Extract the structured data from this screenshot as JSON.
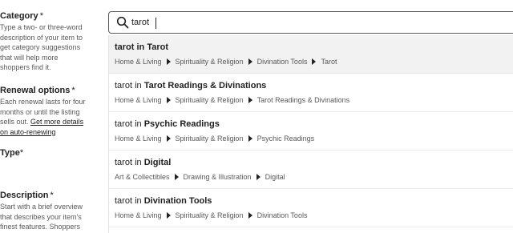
{
  "form": {
    "category": {
      "title": "Category",
      "required_mark": "*",
      "help": "Type a two- or three-word description of your item to get category suggestions that will help more shoppers find it."
    },
    "renewal": {
      "title": "Renewal options",
      "required_mark": "*",
      "help_text": "Each renewal lasts for four months or until the listing sells out.",
      "link": "Get more details on auto-renewing"
    },
    "type": {
      "title": "Type",
      "required_mark": "*"
    },
    "description": {
      "title": "Description",
      "required_mark": "*",
      "help": "Start with a brief overview that describes your item's finest features. Shoppers"
    }
  },
  "search": {
    "value": "tarot",
    "icon": "search-icon"
  },
  "suggestions": [
    {
      "prefix": "tarot in ",
      "category": "Tarot",
      "path": [
        "Home & Living",
        "Spirituality & Religion",
        "Divination Tools",
        "Tarot"
      ]
    },
    {
      "prefix": "tarot in ",
      "category": "Tarot Readings & Divinations",
      "path": [
        "Home & Living",
        "Spirituality & Religion",
        "Tarot Readings & Divinations"
      ]
    },
    {
      "prefix": "tarot in ",
      "category": "Psychic Readings",
      "path": [
        "Home & Living",
        "Spirituality & Religion",
        "Psychic Readings"
      ]
    },
    {
      "prefix": "tarot in ",
      "category": "Digital",
      "path": [
        "Art & Collectibles",
        "Drawing & Illustration",
        "Digital"
      ]
    },
    {
      "prefix": "tarot in ",
      "category": "Divination Tools",
      "path": [
        "Home & Living",
        "Spirituality & Religion",
        "Divination Tools"
      ]
    }
  ],
  "colors": {
    "active_row_bg": "#f2f2f2",
    "text_primary": "#222222",
    "text_secondary": "#595959"
  }
}
